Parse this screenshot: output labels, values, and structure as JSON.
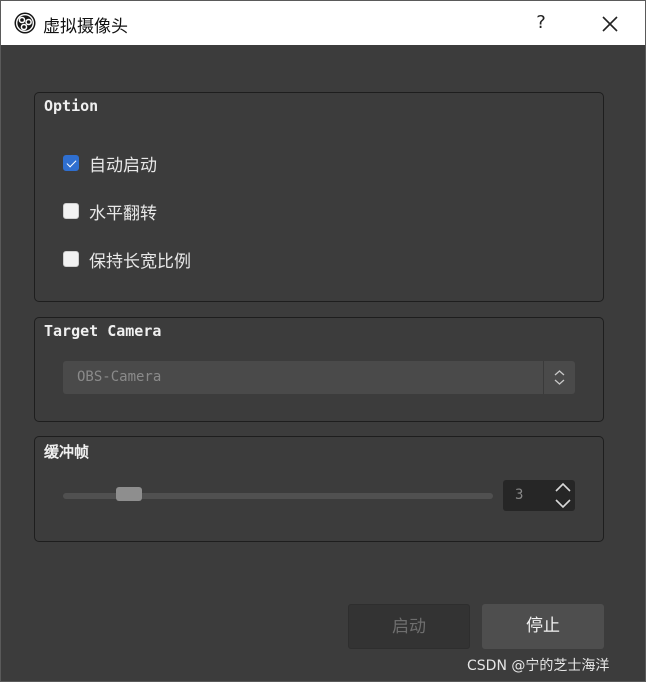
{
  "window": {
    "title": "虚拟摄像头",
    "help_label": "?"
  },
  "option_group": {
    "title": "Option",
    "checkboxes": [
      {
        "label": "自动启动",
        "checked": true
      },
      {
        "label": "水平翻转",
        "checked": false
      },
      {
        "label": "保持长宽比例",
        "checked": false
      }
    ]
  },
  "camera_group": {
    "title": "Target Camera",
    "selected": "OBS-Camera"
  },
  "buffer_group": {
    "title": "缓冲帧",
    "value": "3",
    "slider_fraction": 0.13
  },
  "buttons": {
    "start_label": "启动",
    "stop_label": "停止"
  },
  "watermark": "CSDN @宁的芝士海洋",
  "colors": {
    "accent": "#2f6fd0",
    "panel": "#3c3c3c",
    "titlebar": "#ffffff"
  }
}
